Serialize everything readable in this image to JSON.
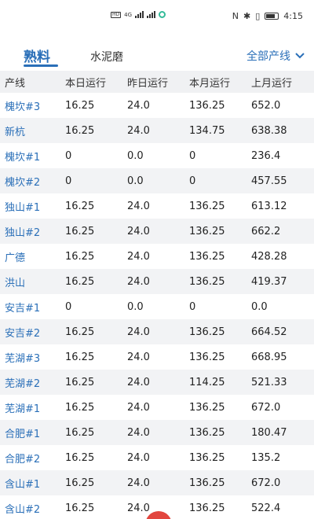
{
  "status_bar": {
    "time": "4:15",
    "network": "4G"
  },
  "nav": {
    "tab_active": "熟料",
    "tab_other": "水泥磨",
    "filter_label": "全部产线"
  },
  "table": {
    "headers": [
      "产线",
      "本日运行",
      "昨日运行",
      "本月运行",
      "上月运行"
    ],
    "rows": [
      [
        "槐坎#3",
        "16.25",
        "24.0",
        "136.25",
        "652.0"
      ],
      [
        "新杭",
        "16.25",
        "24.0",
        "134.75",
        "638.38"
      ],
      [
        "槐坎#1",
        "0",
        "0.0",
        "0",
        "236.4"
      ],
      [
        "槐坎#2",
        "0",
        "0.0",
        "0",
        "457.55"
      ],
      [
        "独山#1",
        "16.25",
        "24.0",
        "136.25",
        "613.12"
      ],
      [
        "独山#2",
        "16.25",
        "24.0",
        "136.25",
        "662.2"
      ],
      [
        "广德",
        "16.25",
        "24.0",
        "136.25",
        "428.28"
      ],
      [
        "洪山",
        "16.25",
        "24.0",
        "136.25",
        "419.37"
      ],
      [
        "安吉#1",
        "0",
        "0.0",
        "0",
        "0.0"
      ],
      [
        "安吉#2",
        "16.25",
        "24.0",
        "136.25",
        "664.52"
      ],
      [
        "芜湖#3",
        "16.25",
        "24.0",
        "136.25",
        "668.95"
      ],
      [
        "芜湖#2",
        "16.25",
        "24.0",
        "114.25",
        "521.33"
      ],
      [
        "芜湖#1",
        "16.25",
        "24.0",
        "136.25",
        "672.0"
      ],
      [
        "合肥#1",
        "16.25",
        "24.0",
        "136.25",
        "180.47"
      ],
      [
        "合肥#2",
        "16.25",
        "24.0",
        "136.25",
        "135.2"
      ],
      [
        "含山#1",
        "16.25",
        "24.0",
        "136.25",
        "672.0"
      ],
      [
        "含山#2",
        "16.25",
        "24.0",
        "136.25",
        "522.4"
      ]
    ]
  },
  "colors": {
    "accent": "#2a6fb8",
    "row_alt": "#f2f3f5",
    "fab": "#e2463f"
  }
}
